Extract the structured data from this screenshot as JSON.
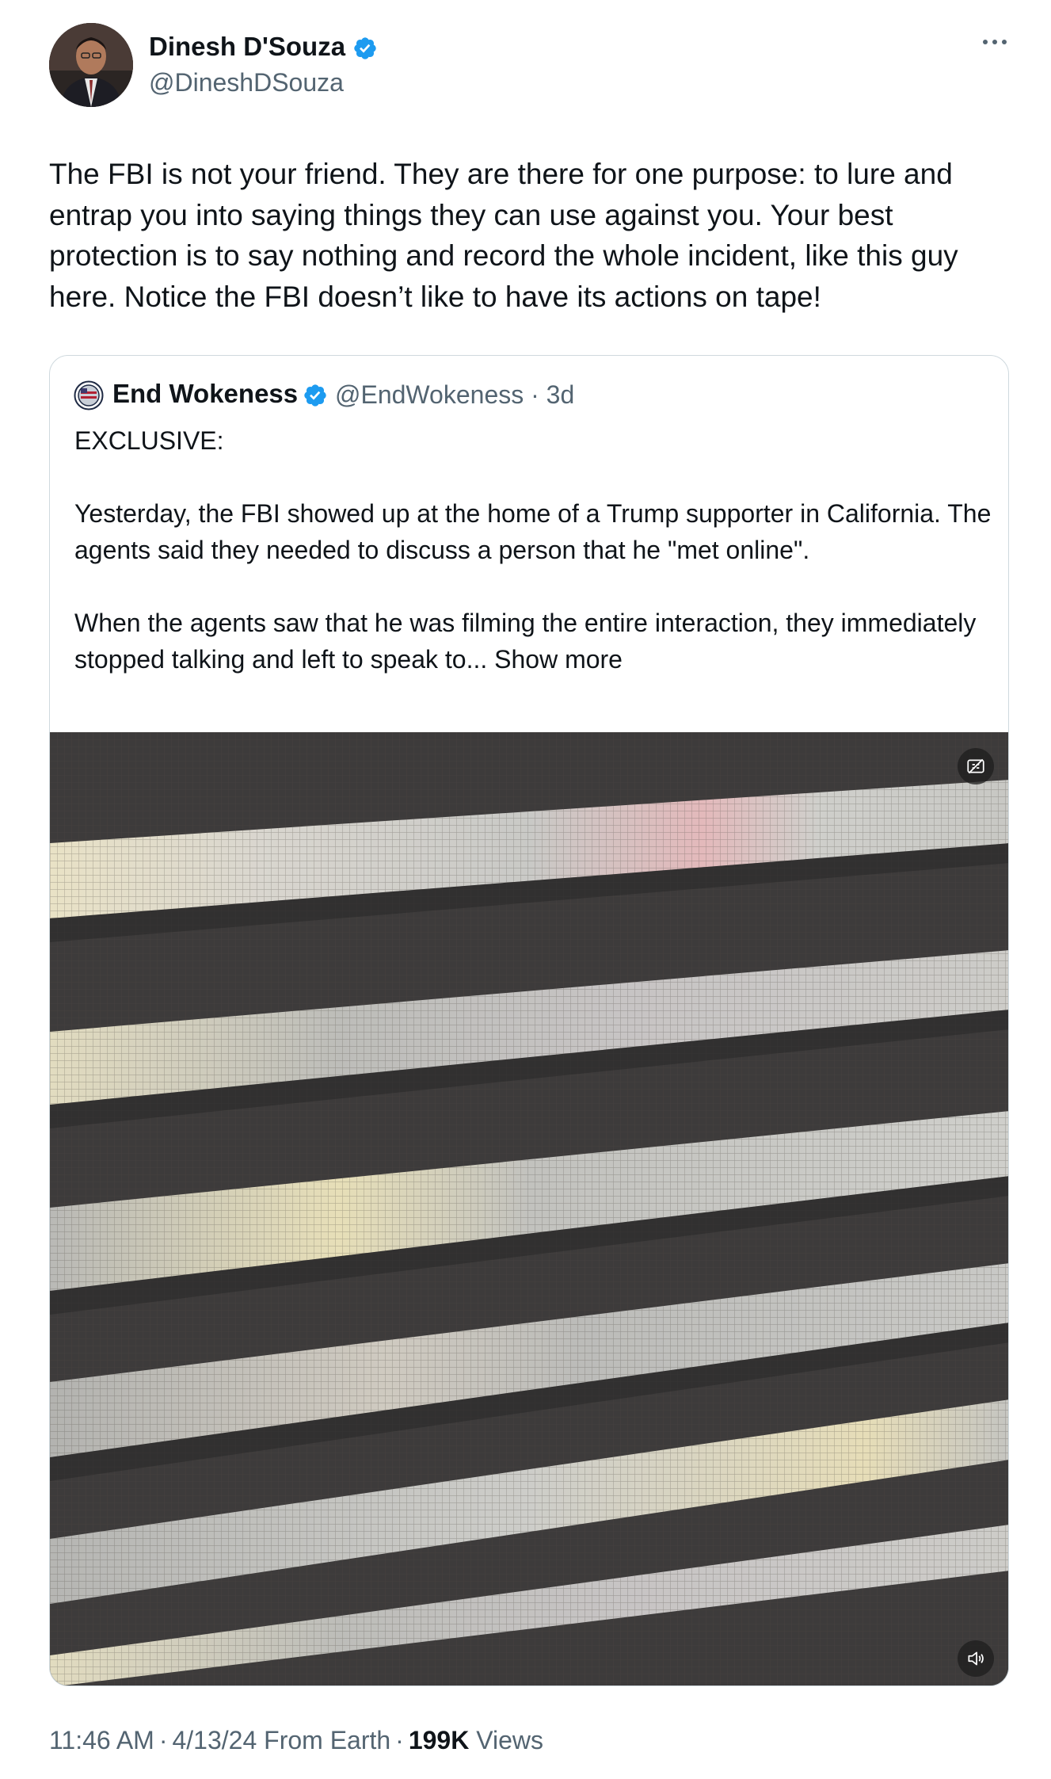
{
  "author": {
    "name": "Dinesh D'Souza",
    "handle": "@DineshDSouza",
    "verified": true
  },
  "tweet": {
    "text": "The FBI is not your friend. They are there for one purpose: to lure and entrap you into saying things they can use against you. Your best protection is to say nothing and record  the whole incident, like this guy here. Notice the FBI doesn’t like to have its actions on tape!"
  },
  "quoted": {
    "name": "End Wokeness",
    "handle": "@EndWokeness",
    "age": "3d",
    "text": "EXCLUSIVE:\n\nYesterday, the FBI showed up at the home of a Trump supporter in California. The agents said they needed to discuss a person that he \"met online\".\n\nWhen the agents saw that he was filming the entire interaction, they immediately stopped talking and left to speak to... ",
    "show_more": "Show more",
    "video": {
      "icons": [
        "captions-off-icon",
        "sound-icon"
      ]
    }
  },
  "footer": {
    "time": "11:46 AM",
    "date": "4/13/24",
    "source": "From Earth",
    "views_count": "199K",
    "views_label": "Views"
  },
  "colors": {
    "text_primary": "#0f1419",
    "text_secondary": "#536471",
    "verified": "#1d9bf0",
    "border": "#cfd9de"
  }
}
